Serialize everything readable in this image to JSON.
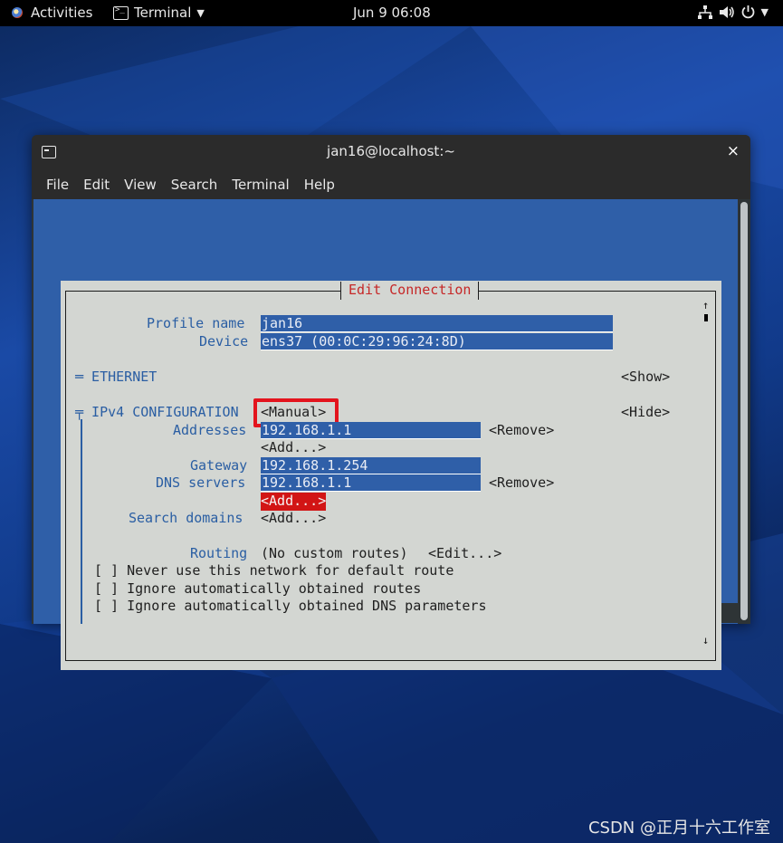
{
  "topbar": {
    "activities": "Activities",
    "app_menu": "Terminal",
    "clock": "Jun 9  06:08"
  },
  "window": {
    "title": "jan16@localhost:~",
    "close": "×",
    "menu": [
      "File",
      "Edit",
      "View",
      "Search",
      "Terminal",
      "Help"
    ]
  },
  "dialog": {
    "title": "Edit Connection",
    "profile_name_label": "Profile name",
    "profile_name_value": "jan16",
    "device_label": "Device",
    "device_value": "ens37 (00:0C:29:96:24:8D)",
    "ethernet_label": "═ ETHERNET",
    "show_button": "<Show>",
    "ipv4_label": "╤ IPv4 CONFIGURATION",
    "ipv4_mode": "<Manual>",
    "hide_button": "<Hide>",
    "addresses_label": "Addresses",
    "address_value": "192.168.1.1",
    "remove_button": "<Remove>",
    "add_button": "<Add...>",
    "gateway_label": "Gateway",
    "gateway_value": "192.168.1.254",
    "dns_label": "DNS servers",
    "dns_value": "192.168.1.1",
    "dns_remove_button": "<Remove>",
    "dns_add_button": "<Add...>",
    "search_domains_label": "Search domains",
    "search_add_button": "<Add...>",
    "routing_label": "Routing",
    "routing_value": "(No custom routes)",
    "routing_edit_button": "<Edit...>",
    "check_never_default": "[ ] Never use this network for default route",
    "check_ignore_routes": "[ ] Ignore automatically obtained routes",
    "check_ignore_dns": "[ ] Ignore automatically obtained DNS parameters",
    "scroll_up": "↑",
    "scroll_down": "↓"
  },
  "watermark": "CSDN @正月十六工作室",
  "colors": {
    "terminal_bg": "#2f5fa8",
    "dialog_bg": "#d3d6d2",
    "label_blue": "#2a5ea3",
    "focus_red": "#d21515",
    "highlight_red": "#e3141d"
  }
}
